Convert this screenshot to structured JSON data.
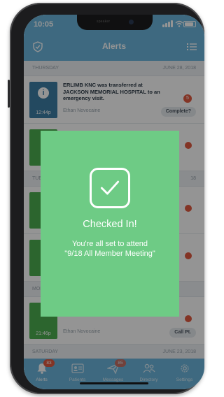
{
  "status": {
    "time": "10:05"
  },
  "nav": {
    "title": "Alerts"
  },
  "sections": {
    "thursday": {
      "day": "THURSDAY",
      "date": "JUNE 28, 2018"
    },
    "tuesday": {
      "day": "TUE",
      "date": "18"
    },
    "monday": {
      "day": "MON"
    },
    "saturday": {
      "day": "SATURDAY",
      "date": "JUNE 23, 2018"
    }
  },
  "alert1": {
    "text": "ERLIMB KNC was transferred at JACKSON MEMORIAL HOSPITAL to an emergency visit.",
    "name": "Ethan Novocaine",
    "time": "12:44p",
    "action": "Complete?",
    "count": "5",
    "icon": "info-icon",
    "tile_color": "#3d7ea6"
  },
  "alert_last": {
    "name": "Ethan Novocaine",
    "time": "21:46p",
    "action": "Call Pt.",
    "tile_color": "#4caf50"
  },
  "modal": {
    "title": "Checked In!",
    "line1": "You're all set to attend",
    "line2": "\"9/18 All Member Meeting\"",
    "icon": "checkmark-icon",
    "color": "#6ecb85"
  },
  "tabs": [
    {
      "label": "Alerts",
      "badge": "83",
      "icon": "bell-icon"
    },
    {
      "label": "Patients",
      "badge": "",
      "icon": "id-card-icon"
    },
    {
      "label": "Messages",
      "badge": "85",
      "icon": "paper-plane-icon"
    },
    {
      "label": "Directory",
      "badge": "",
      "icon": "people-icon"
    },
    {
      "label": "Settings",
      "badge": "",
      "icon": "gear-icon"
    }
  ],
  "colors": {
    "header": "#6cb6dc",
    "badge": "#e25a40"
  }
}
